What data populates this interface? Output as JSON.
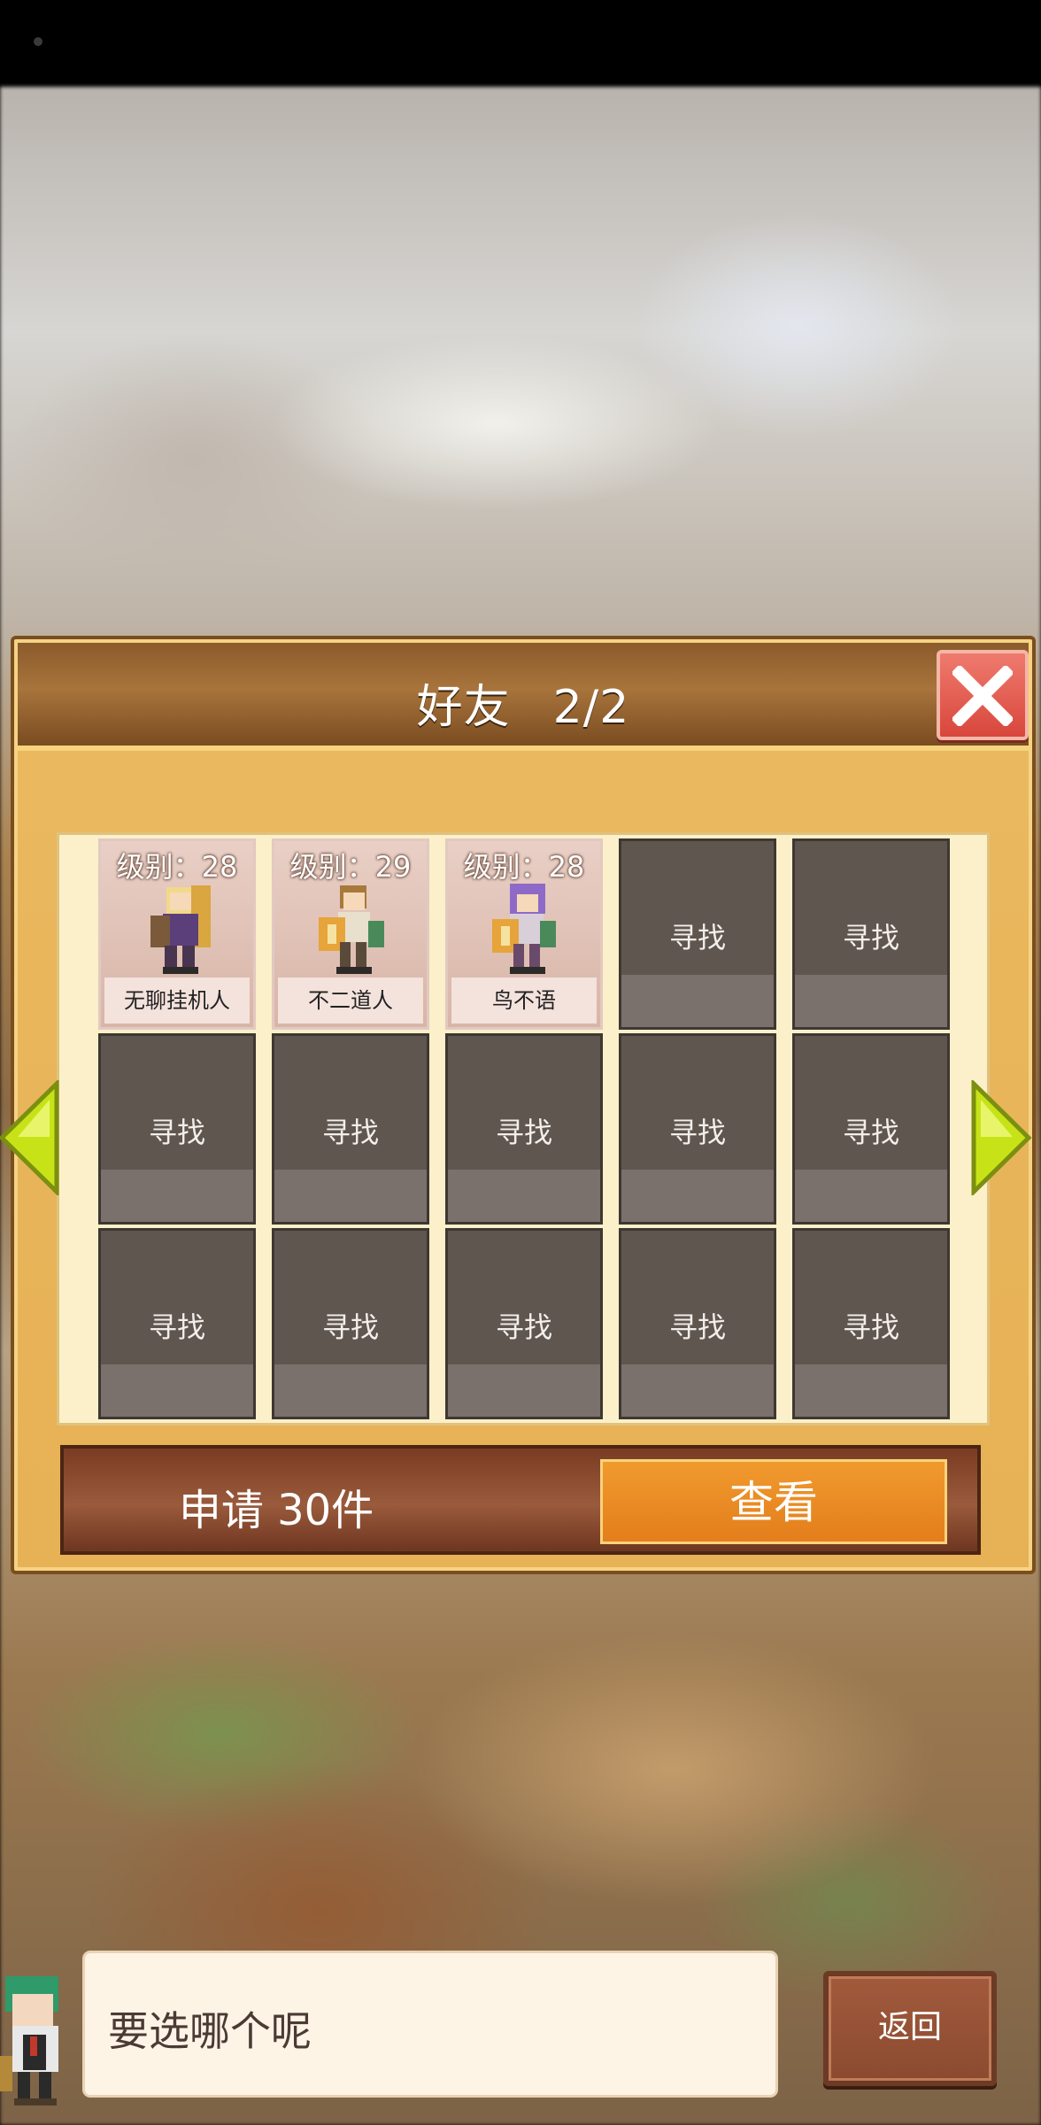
{
  "dialog": {
    "title": "好友",
    "count": "2/2",
    "friends": [
      {
        "level": "级别：28",
        "name": "无聊挂机人"
      },
      {
        "level": "级别：29",
        "name": "不二道人"
      },
      {
        "level": "级别：28",
        "name": "鸟不语"
      }
    ],
    "empty_slot_label": "寻找",
    "request_label": "申请 30件",
    "view_label": "查看"
  },
  "bottom": {
    "message": "要选哪个呢",
    "back_label": "返回"
  },
  "colors": {
    "panel": "#e7b155",
    "header": "#8c5b2b",
    "close": "#d8473c",
    "empty_slot": "#5f5650",
    "view_button": "#e37e1c"
  }
}
